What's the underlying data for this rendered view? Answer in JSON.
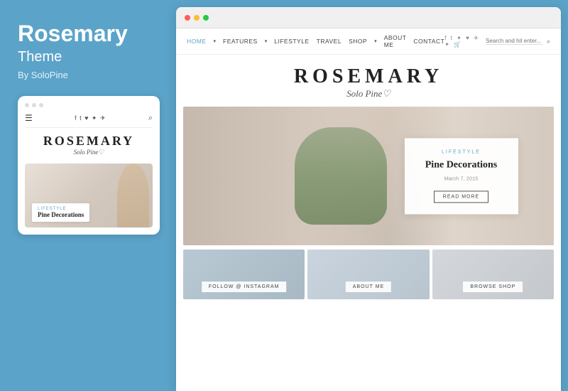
{
  "left": {
    "title": "Rosemary",
    "subtitle": "Theme",
    "author": "By SoloPine",
    "mobile": {
      "dots": [
        "dot1",
        "dot2",
        "dot3"
      ],
      "logo_text": "ROSEMARY",
      "logo_sub": "Solo Pine♡",
      "hero_category": "LIFESTYLE",
      "hero_title": "Pine Decorations"
    }
  },
  "right": {
    "browser_dots": [
      "red",
      "yellow",
      "green"
    ],
    "nav": {
      "items": [
        "HOME",
        "FEATURES",
        "LIFESTYLE",
        "TRAVEL",
        "SHOP",
        "ABOUT ME",
        "CONTACT"
      ],
      "search_placeholder": "Search and hit enter..."
    },
    "logo": {
      "text": "ROSEMARY",
      "sub": "Solo Pine♡"
    },
    "hero": {
      "category": "LIFESTYLE",
      "title": "Pine Decorations",
      "date": "March 7, 2015",
      "button": "READ MORE"
    },
    "grid": [
      {
        "label": "FOLLOW @ INSTAGRAM"
      },
      {
        "label": "ABOUT ME"
      },
      {
        "label": "BROWSE SHOP"
      }
    ]
  }
}
